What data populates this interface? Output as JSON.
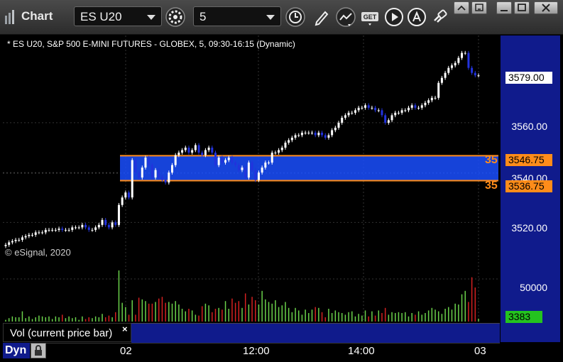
{
  "app": {
    "title": "Chart"
  },
  "toolbar": {
    "symbol": "ES U20",
    "interval": "5"
  },
  "chart": {
    "caption": "* ES U20, S&P 500 E-MINI FUTURES - GLOBEX, 5, 09:30-16:15 (Dynamic)",
    "copyright": "© eSignal, 2020",
    "price_ticks": [
      "3560.00",
      "3540.00",
      "3520.00"
    ],
    "last_price": "3579.00",
    "hline_upper": {
      "label": "35",
      "price": "3546.75"
    },
    "hline_lower": {
      "label": "35",
      "price": "3536.75"
    },
    "volume_tick": "50000",
    "volume_last": "3383",
    "volume_legend": "Vol (current price bar)",
    "time_ticks": [
      "02",
      "12:00",
      "14:00",
      "03"
    ],
    "mode_button": "Dyn"
  },
  "colors": {
    "axis_blue": "#101b8c",
    "zone_blue": "#1a4fff",
    "orange": "#ff8c1a",
    "up_candle": "#ffffff",
    "down_candle": "#2233dd",
    "vol_up": "#6ad14a",
    "vol_down": "#d42020"
  },
  "chart_data": {
    "type": "candlestick",
    "symbol": "ES U20",
    "interval": "5",
    "price_axis": {
      "min": 3505,
      "max": 3595,
      "ticks": [
        3520,
        3540,
        3560
      ]
    },
    "closes": [
      3511,
      3512,
      3512.5,
      3513,
      3513,
      3514,
      3514.5,
      3515,
      3515,
      3516,
      3516,
      3516,
      3517,
      3517,
      3517,
      3517,
      3517.5,
      3517,
      3517,
      3517,
      3518,
      3518,
      3518,
      3519,
      3518,
      3517,
      3517,
      3518,
      3519,
      3521,
      3519,
      3518,
      3520,
      3519,
      3527,
      3530,
      3532,
      3530,
      3545,
      3540,
      3538,
      3542,
      3546,
      3543,
      3538,
      3541,
      3538,
      3537,
      3536,
      3540,
      3543,
      3547,
      3548,
      3549,
      3550,
      3548,
      3549,
      3551,
      3548,
      3547,
      3549,
      3550,
      3548,
      3543,
      3546,
      3544,
      3545,
      3546,
      3544,
      3543,
      3541,
      3542,
      3538,
      3544,
      3541,
      3537,
      3540,
      3542,
      3544,
      3544,
      3548,
      3548,
      3549,
      3550,
      3552,
      3553,
      3554,
      3555,
      3555,
      3556,
      3556,
      3556,
      3556,
      3555,
      3556,
      3555,
      3554,
      3555,
      3557,
      3558,
      3560,
      3562,
      3563,
      3564,
      3564,
      3565,
      3566,
      3566,
      3567,
      3566,
      3566,
      3565,
      3565,
      3563,
      3560,
      3561,
      3563,
      3564,
      3564,
      3565,
      3565,
      3566,
      3567,
      3566,
      3566,
      3567,
      3568,
      3569,
      3570,
      3570,
      3576,
      3578,
      3580,
      3582,
      3583,
      3584,
      3586,
      3588,
      3588,
      3582,
      3580,
      3579,
      3579
    ],
    "volume_axis": {
      "min": 0,
      "max": 70000,
      "ticks": [
        50000
      ]
    },
    "volumes": [
      2000,
      4000,
      6000,
      5000,
      5000,
      12000,
      4000,
      6000,
      3000,
      5000,
      7000,
      6000,
      5000,
      6000,
      3000,
      6000,
      5000,
      8000,
      4000,
      6000,
      4000,
      5000,
      2000,
      6000,
      3000,
      5000,
      4000,
      6000,
      5000,
      9000,
      5000,
      7000,
      5000,
      11000,
      60000,
      22000,
      17000,
      8000,
      25000,
      8000,
      28000,
      26000,
      24000,
      21000,
      21000,
      23000,
      27000,
      29000,
      22000,
      23000,
      21000,
      24000,
      20000,
      15000,
      12000,
      15000,
      13000,
      8000,
      7000,
      18000,
      21000,
      19000,
      11000,
      15000,
      16000,
      14000,
      24000,
      15000,
      27000,
      22000,
      24000,
      16000,
      33000,
      20000,
      29000,
      25000,
      20000,
      36000,
      26000,
      23000,
      21000,
      25000,
      17000,
      19000,
      23000,
      16000,
      11000,
      16000,
      13000,
      8000,
      14000,
      10000,
      14000,
      17000,
      16000,
      11000,
      5000,
      15000,
      10000,
      13000,
      11000,
      10000,
      8000,
      11000,
      12000,
      6000,
      9000,
      7000,
      13000,
      6000,
      12000,
      7000,
      13000,
      10000,
      16000,
      8000,
      11000,
      10000,
      11000,
      10000,
      11000,
      6000,
      10000,
      8000,
      12000,
      8000,
      10000,
      13000,
      16000,
      14000,
      12000,
      9000,
      15000,
      17000,
      14000,
      21000,
      20000,
      32000,
      36000,
      23000,
      52000,
      40000,
      3383
    ],
    "zone": {
      "upper": 3546.75,
      "lower": 3536.75
    },
    "last_price": 3579.0,
    "time_ticks": [
      "02",
      "12:00",
      "14:00",
      "03"
    ]
  }
}
